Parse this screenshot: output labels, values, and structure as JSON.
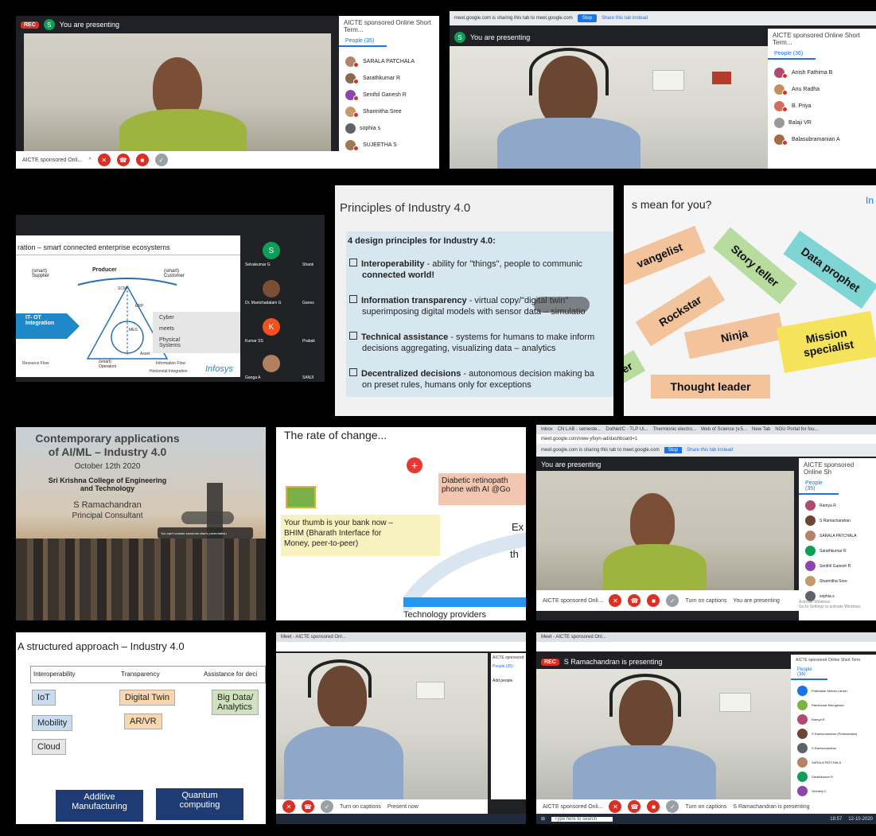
{
  "t1": {
    "rec": "REC",
    "avatar": "S",
    "presenting": "You are presenting",
    "panel_title": "AICTE sponsored Online Short Term...",
    "people_tab": "People (35)",
    "people": [
      "SARALA PATCHALA",
      "Sarathkumar R",
      "Senthil Ganesh R",
      "Sharmitha Sree",
      "sophia s",
      "SUJEETHA S"
    ],
    "meeting_name": "AICTE sponsored Onli...",
    "chevron": "^"
  },
  "t2": {
    "url": "meet.google.com is sharing this tab to meet.google.com",
    "stop": "Stop",
    "share_this": "Share this tab instead",
    "avatar": "S",
    "presenting": "You are presenting",
    "panel_title": "AICTE sponsored Online Short Term...",
    "people_tab": "People (36)",
    "people": [
      "Anish Fathima B",
      "Anu Radha",
      "B. Priya",
      "Balaji VR",
      "Balasubramanian A"
    ]
  },
  "t3": {
    "title": "ration – smart connected enterprise ecosystems",
    "producer": "Producer",
    "supplier": "(smart)\nSupplier",
    "customer": "(smart)\nCustomer",
    "itot": "IT- OT\nIntegration",
    "cyber": "Cyber",
    "meets": "meets",
    "physical": "Physical\nSystems",
    "operators": "(smart)\nOperators",
    "resource": "Resource Flow",
    "information": "Information Flow",
    "horizontal": "Horizontal Integration",
    "scm": "SCM",
    "erp": "ERP",
    "mes": "MES",
    "asset": "Asset",
    "brand": "Infosys",
    "participants": [
      {
        "initial": "S",
        "name": "Selvakumar G",
        "color": "#0f9d58"
      },
      {
        "initial": "",
        "name": "Dr. Manichadalam G",
        "color": "#7a4f35"
      },
      {
        "initial": "K",
        "name": "Kumar SS",
        "color": "#f4511e"
      },
      {
        "initial": "",
        "name": "Ganga A",
        "color": "#b08060"
      }
    ],
    "participants_right": [
      "Shank",
      "Ganes",
      "Prabak",
      "SANJI"
    ]
  },
  "t4": {
    "title": "Principles of Industry 4.0",
    "subtitle": "4 design principles for Industry 4.0:",
    "items": [
      {
        "lead": "Interoperability",
        "rest": " - ability for \"things\", people to communic",
        "line2": "connected world!"
      },
      {
        "lead": "Information transparency",
        "rest": " - virtual copy/\"digital twin\"",
        "line2": "superimposing digital models with sensor data – simulatio"
      },
      {
        "lead": "Technical assistance",
        "rest": " - systems for humans to make inform",
        "line2": "decisions aggregating, visualizing data – analytics"
      },
      {
        "lead": "Decentralized decisions",
        "rest": " - autonomous decision making ba",
        "line2": "on preset rules, humans only for exceptions"
      }
    ]
  },
  "t5": {
    "title": "s mean for you?",
    "corner": "In",
    "stickies": [
      "vangelist",
      "Story teller",
      "Data prophet",
      "Rockstar",
      "Ninja",
      "Mission\nspecialist",
      "Thought leader",
      "er"
    ]
  },
  "t6": {
    "title": "Contemporary applications\nof AI/ML – Industry 4.0",
    "date": "October 12th 2020",
    "college": "Sri Krishna College of Engineering\nand Technology",
    "presenter": "S Ramachandran",
    "role": "Principal Consultant",
    "toast": "You can't unmute someone else's presentation"
  },
  "t7": {
    "title": "The rate of change...",
    "bank": "Your thumb is your bank now –\nBHIM (Bharath Interface for\nMoney, peer-to-peer)",
    "diabetic": "Diabetic retinopath\nphone with AI @Go",
    "ex": "Ex",
    "th": "th",
    "providers": "Technology providers"
  },
  "t8": {
    "tabs": [
      "Inbox",
      "CN LAB - semeste...",
      "DotNet/C - TLP Ui...",
      "Thermionic electro...",
      "Web of Science (v.5...",
      "New Tab",
      "NGU Portal for fou..."
    ],
    "url": "meet.google.com/vww-yfoyn-ad/dashboard=1",
    "sharing": "meet.google.com is sharing this tab to meet.google.com",
    "stop": "Stop",
    "share_this": "Share this tab instead",
    "presenting": "You are presenting",
    "panel_title": "AICTE sponsored Online Sh",
    "people_tab": "People (35)",
    "people": [
      "Ramya R",
      "S Ramachandran",
      "SARALA PATCHALA",
      "Sarathkumar R",
      "Senthil Ganesh R",
      "Sharmitha Sree",
      "sophia s"
    ],
    "meeting_name": "AICTE sponsored Onli...",
    "captions": "Turn on captions",
    "you_presenting": "You are presenting",
    "activate": "Activate Windows\nGo to Settings to activate Windows."
  },
  "t9": {
    "title": "A structured approach – Industry 4.0",
    "headers": [
      "Interoperability",
      "Transparency",
      "Assistance for deci"
    ],
    "items": [
      "IoT",
      "Mobility",
      "Cloud",
      "Digital Twin",
      "AR/VR",
      "Big Data/\nAnalytics",
      "Additive\nManufacturing",
      "Quantum\ncomputing"
    ]
  },
  "t10": {
    "tab": "Meet - AICTE sponsored Onl...",
    "panel_title": "AICTE sponsored",
    "people_tab": "People (35)",
    "add": "Add people",
    "captions": "Turn on captions",
    "present": "Present now"
  },
  "t11": {
    "tab": "Meet - AICTE sponsored Onl...",
    "presenting": "S Ramachandran is presenting",
    "rec": "REC",
    "panel_title": "AICTE sponsored Online Short Term",
    "people_tab": "People (36)",
    "people": [
      "Prabhakar Mohan Lansin",
      "Ramkumar Murugesan",
      "Ramya R",
      "S Ramachandran (Presentation)",
      "S Ramachandran",
      "SARALA PATCHALA",
      "Sarathkumar R",
      "Selvaraj C"
    ],
    "meeting_name": "AICTE sponsored Onli...",
    "captions": "Turn on captions",
    "is_presenting": "S Ramachandran is presenting",
    "search": "Type here to search",
    "time": "18:57",
    "date": "12-10-2020"
  },
  "colors": {
    "meet_red": "#d93025",
    "meet_dark": "#202124",
    "green": "#0f9d58",
    "orange_sticky": "#f3c39c",
    "yellow_sticky": "#f5e35c",
    "teal_sticky": "#7fd4d4",
    "green_sticky": "#b7dc9e"
  }
}
